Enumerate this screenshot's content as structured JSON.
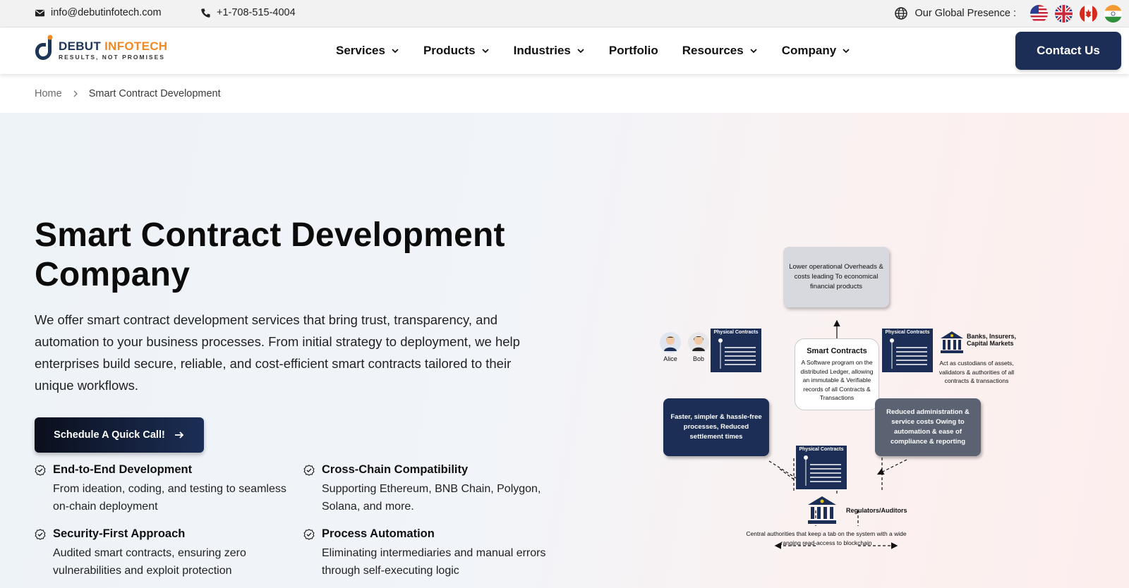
{
  "topbar": {
    "email": "info@debutinfotech.com",
    "phone": "+1-708-515-4004",
    "presence_label": "Our Global Presence :",
    "flags": [
      "us-flag-icon",
      "uk-flag-icon",
      "canada-flag-icon",
      "india-flag-icon"
    ]
  },
  "logo": {
    "name_primary": "DEBUT",
    "name_accent": "INFOTECH",
    "tagline": "RESULTS, NOT PROMISES"
  },
  "nav": {
    "items": [
      {
        "label": "Services",
        "dropdown": true
      },
      {
        "label": "Products",
        "dropdown": true
      },
      {
        "label": "Industries",
        "dropdown": true
      },
      {
        "label": "Portfolio",
        "dropdown": false
      },
      {
        "label": "Resources",
        "dropdown": true
      },
      {
        "label": "Company",
        "dropdown": true
      }
    ],
    "contact_label": "Contact Us"
  },
  "breadcrumb": {
    "home": "Home",
    "current": "Smart Contract Development"
  },
  "hero": {
    "title": "Smart Contract Development Company",
    "description": "We offer smart contract development services that bring trust, transparency, and automation to your business processes. From initial strategy to deployment, we help enterprises build secure, reliable, and cost-efficient smart contracts tailored to their unique workflows.",
    "cta_label": "Schedule A Quick Call!",
    "features": [
      {
        "title": "End-to-End Development",
        "desc": "From ideation, coding, and testing to seamless on-chain deployment"
      },
      {
        "title": "Cross-Chain Compatibility",
        "desc": "Supporting Ethereum, BNB Chain, Polygon, Solana, and more."
      },
      {
        "title": "Security-First Approach",
        "desc": "Audited smart contracts, ensuring zero vulnerabilities and exploit protection"
      },
      {
        "title": "Process Automation",
        "desc": "Eliminating intermediaries and manual errors through self-executing logic"
      }
    ]
  },
  "diagram": {
    "top_box": "Lower operational Overheads & costs leading To economical financial products",
    "center_title": "Smart Contracts",
    "center_text": "A Software program on the distributed Ledger, allowing an immutable & Verifiable records of all Contracts & Transactions",
    "left_box": "Faster, simpler & hassle-free processes, Reduced settlement times",
    "right_box": "Reduced administration & service costs Owing to automation & ease of compliance & reporting",
    "physical_contracts_label": "Physical Contracts",
    "alice": "Alice",
    "bob": "Bob",
    "banks_title": "Banks, Insurers, Capital Markets",
    "banks_desc": "Act as custodians of assets, validators & authorities of all contracts & transactions",
    "regulators_title": "Regulators/Auditors",
    "regulators_desc": "Central authorities that keep a tab on the system with a wide ranging read-access to blockchain"
  }
}
